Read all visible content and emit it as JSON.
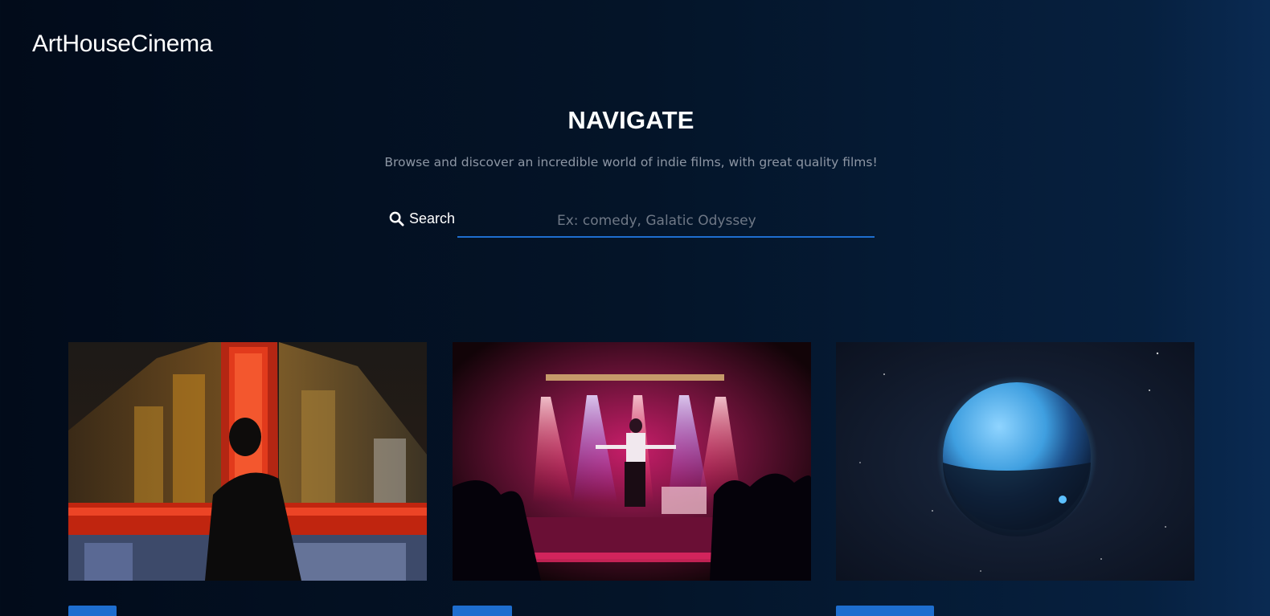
{
  "header": {
    "logo": "ArtHouseCinema"
  },
  "hero": {
    "title": "NAVIGATE",
    "subtitle": "Browse and discover an incredible world of indie films, with great quality films!"
  },
  "search": {
    "label": "Search",
    "placeholder": "Ex: comedy, Galatic Odyssey",
    "value": ""
  },
  "cards": [
    {
      "image_icon": "neon-city-night-image"
    },
    {
      "image_icon": "stage-performance-image"
    },
    {
      "image_icon": "blue-planet-space-image"
    }
  ],
  "colors": {
    "accent": "#1e6ecf",
    "background": "#041428",
    "muted_text": "#8d96a4"
  }
}
